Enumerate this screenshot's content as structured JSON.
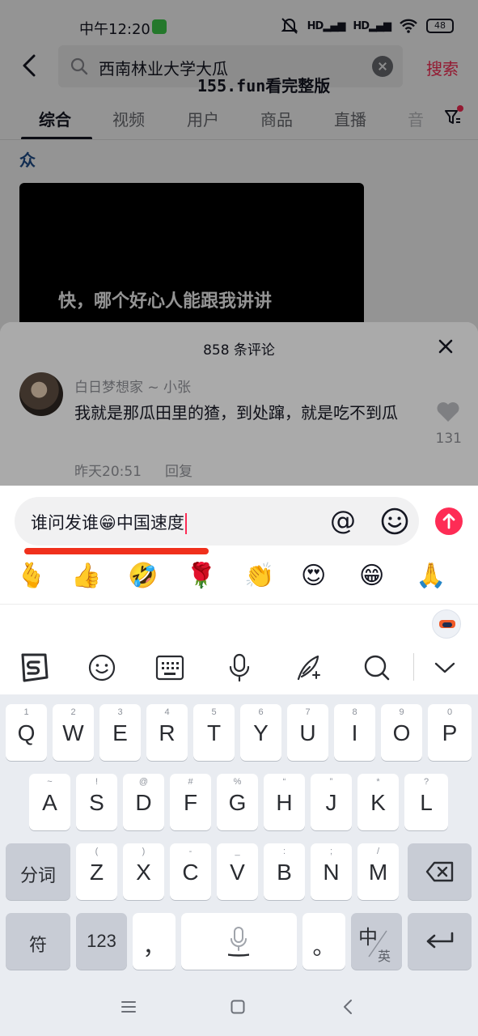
{
  "status_bar": {
    "time": "中午12:20",
    "signal1": "HD",
    "signal2": "HD",
    "battery": "48"
  },
  "search": {
    "query": "西南林业大学大瓜",
    "button": "搜索"
  },
  "watermark": {
    "domain": "155.fun",
    "suffix": "看完整版"
  },
  "tabs": [
    {
      "label": "综合",
      "active": true
    },
    {
      "label": "视频",
      "active": false
    },
    {
      "label": "用户",
      "active": false
    },
    {
      "label": "商品",
      "active": false
    },
    {
      "label": "直播",
      "active": false
    },
    {
      "label": "音",
      "active": false
    }
  ],
  "background": {
    "partial_char": "众",
    "video_caption": "快，哪个好心人能跟我讲讲"
  },
  "comments_sheet": {
    "title": "858 条评论",
    "comment": {
      "user": "白日梦想家 ~ 小张",
      "text": "我就是那瓜田里的猹，到处蹿，就是吃不到瓜",
      "time": "昨天20:51",
      "reply": "回复",
      "likes": "131"
    }
  },
  "comment_input": {
    "value": "谁问发谁😁中国速度",
    "at_symbol": "@"
  },
  "emoji_bar": [
    "🫰",
    "👍",
    "🤣",
    "🌹",
    "👏",
    "😍",
    "😁",
    "🙏"
  ],
  "ime_toolbar": {
    "icons": [
      "sogou-logo-icon",
      "emoji-icon",
      "keyboard-icon",
      "microphone-icon",
      "handwriting-icon",
      "search-icon",
      "collapse-chevron-icon"
    ]
  },
  "keyboard": {
    "row1": [
      {
        "main": "Q",
        "hint": "1"
      },
      {
        "main": "W",
        "hint": "2"
      },
      {
        "main": "E",
        "hint": "3"
      },
      {
        "main": "R",
        "hint": "4"
      },
      {
        "main": "T",
        "hint": "5"
      },
      {
        "main": "Y",
        "hint": "6"
      },
      {
        "main": "U",
        "hint": "7"
      },
      {
        "main": "I",
        "hint": "8"
      },
      {
        "main": "O",
        "hint": "9"
      },
      {
        "main": "P",
        "hint": "0"
      }
    ],
    "row2": [
      {
        "main": "A",
        "hint": "~"
      },
      {
        "main": "S",
        "hint": "!"
      },
      {
        "main": "D",
        "hint": "@"
      },
      {
        "main": "F",
        "hint": "#"
      },
      {
        "main": "G",
        "hint": "%"
      },
      {
        "main": "H",
        "hint": "“"
      },
      {
        "main": "J",
        "hint": "”"
      },
      {
        "main": "K",
        "hint": "*"
      },
      {
        "main": "L",
        "hint": "?"
      }
    ],
    "row3_left": "分词",
    "row3": [
      {
        "main": "Z",
        "hint": "("
      },
      {
        "main": "X",
        "hint": ")"
      },
      {
        "main": "C",
        "hint": "-"
      },
      {
        "main": "V",
        "hint": "_"
      },
      {
        "main": "B",
        "hint": ":"
      },
      {
        "main": "N",
        "hint": ";"
      },
      {
        "main": "M",
        "hint": "/"
      }
    ],
    "row4": {
      "symbols": "符",
      "numbers": "123",
      "comma": "，",
      "period": "。",
      "lang_main": "中",
      "lang_sub": "英"
    }
  }
}
